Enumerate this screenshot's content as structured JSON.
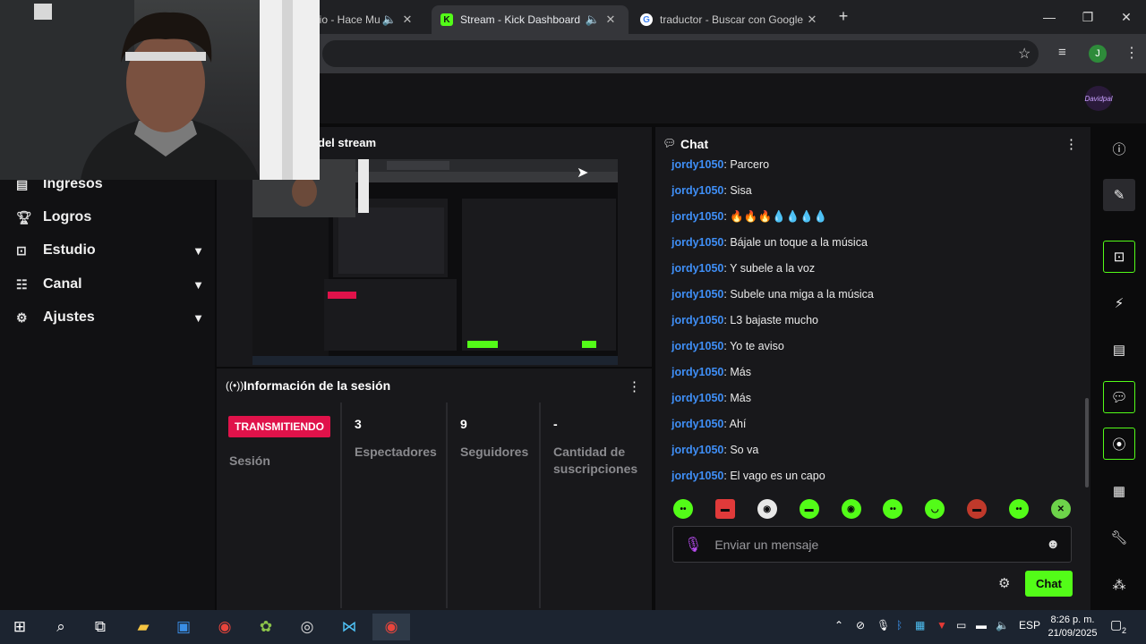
{
  "browser": {
    "tabs": [
      {
        "label": "nio - Hace Mu",
        "active": false
      },
      {
        "label": "Stream - Kick Dashboard",
        "active": true
      },
      {
        "label": "traductor - Buscar con Google",
        "active": false
      }
    ],
    "new_tab": "+",
    "profile_initial": "J"
  },
  "nav": {
    "items": [
      {
        "label": "Ingresos",
        "icon": "income-icon",
        "has_chevron": false
      },
      {
        "label": "Logros",
        "icon": "trophy-icon",
        "has_chevron": false
      },
      {
        "label": "Estudio",
        "icon": "studio-icon",
        "has_chevron": true
      },
      {
        "label": "Canal",
        "icon": "channel-icon",
        "has_chevron": true
      },
      {
        "label": "Ajustes",
        "icon": "gear-icon",
        "has_chevron": true
      }
    ]
  },
  "preview": {
    "title": "del stream"
  },
  "session": {
    "title": "Información de la sesión",
    "badge": "TRANSMITIENDO",
    "stats": [
      {
        "value": "",
        "label": "Sesión"
      },
      {
        "value": "3",
        "label": "Espectadores"
      },
      {
        "value": "9",
        "label": "Seguidores"
      },
      {
        "value": "-",
        "label": "Cantidad de suscripciones"
      }
    ]
  },
  "chat": {
    "title": "Chat",
    "messages": [
      {
        "user": "jordy1050",
        "text": "Parcero"
      },
      {
        "user": "jordy1050",
        "text": "Sisa"
      },
      {
        "user": "jordy1050",
        "text": "🔥🔥🔥💧💧💧💧"
      },
      {
        "user": "jordy1050",
        "text": "Bájale un toque a la música"
      },
      {
        "user": "jordy1050",
        "text": "Y subele a la voz"
      },
      {
        "user": "jordy1050",
        "text": "Subele una miga a la música"
      },
      {
        "user": "jordy1050",
        "text": "L3 bajaste mucho"
      },
      {
        "user": "jordy1050",
        "text": "Yo te aviso"
      },
      {
        "user": "jordy1050",
        "text": "Más"
      },
      {
        "user": "jordy1050",
        "text": "Más"
      },
      {
        "user": "jordy1050",
        "text": "Ahí"
      },
      {
        "user": "jordy1050",
        "text": "So va"
      },
      {
        "user": "jordy1050",
        "text": "El vago es un capo"
      }
    ],
    "input_placeholder": "Enviar un mensaje",
    "send_label": "Chat"
  },
  "taskbar": {
    "language": "ESP",
    "time": "8:26 p. m.",
    "date": "21/09/2025",
    "notifications": "2"
  },
  "colors": {
    "accent": "#53fc18",
    "live": "#e0124a",
    "username": "#3f8ff7"
  }
}
